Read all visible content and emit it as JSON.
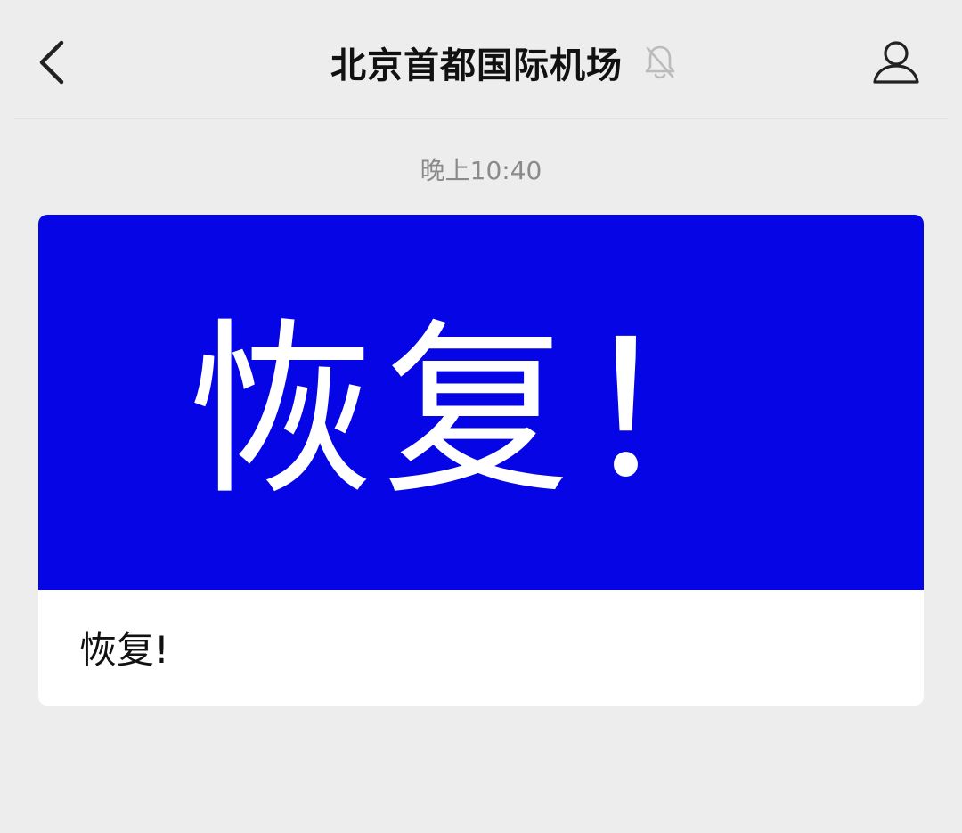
{
  "header": {
    "title": "北京首都国际机场",
    "back_icon": "chevron-left-icon",
    "mute_icon": "bell-off-icon",
    "profile_icon": "person-icon"
  },
  "chat": {
    "timestamp": "晚上10:40",
    "article_card": {
      "cover_text": "恢复！",
      "cover_color": "#0505e6",
      "title": "恢复!"
    }
  }
}
